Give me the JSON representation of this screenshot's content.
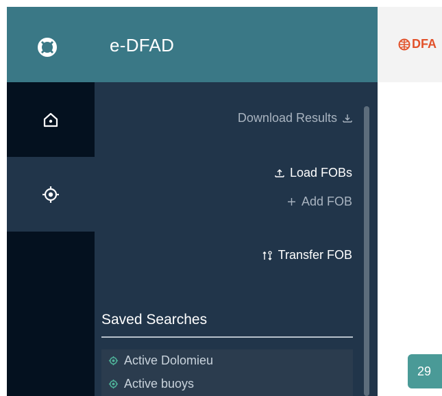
{
  "header": {
    "app_title": "e-DFAD",
    "brand_text": "DFA"
  },
  "rail": {
    "items": [
      {
        "name": "home",
        "icon": "home-icon",
        "active": false
      },
      {
        "name": "location",
        "icon": "crosshair-icon",
        "active": true
      }
    ]
  },
  "panel": {
    "actions": {
      "download_results": "Download Results",
      "load_fobs": "Load FOBs",
      "add_fob": "Add FOB",
      "transfer_fob": "Transfer FOB"
    },
    "saved_searches": {
      "title": "Saved Searches",
      "items": [
        "Active Dolomieu",
        "Active buoys"
      ]
    }
  },
  "badge": {
    "value": "29"
  },
  "colors": {
    "header_teal": "#3a7886",
    "rail_dark": "#04111f",
    "panel_bg": "#21354a",
    "brand_orange": "#e2522b",
    "saved_icon_green": "#4fb39a",
    "badge_teal": "#4a9a97"
  }
}
